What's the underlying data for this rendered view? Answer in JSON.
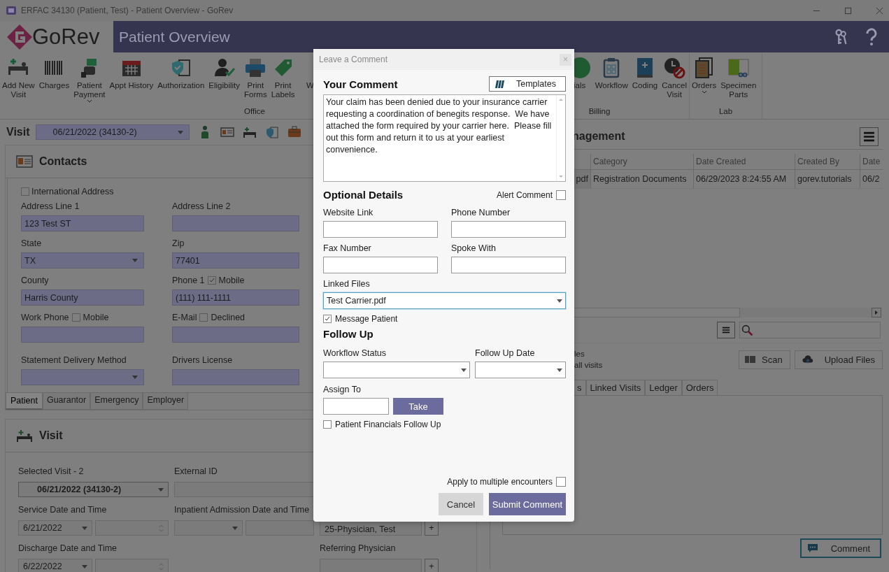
{
  "window": {
    "title": "ERFAC 34130 (Patient, Test) - Patient Overview - GoRev"
  },
  "header": {
    "logo": "GoRev",
    "title": "Patient Overview"
  },
  "ribbon": {
    "groups": [
      {
        "label": "Office",
        "items": [
          {
            "label": "Add New\nVisit",
            "dropdown": false
          },
          {
            "label": "Charges",
            "dropdown": false
          },
          {
            "label": "Patient\nPayment",
            "dropdown": true
          },
          {
            "label": "Appt History",
            "dropdown": false
          },
          {
            "label": "Authorization",
            "dropdown": false
          },
          {
            "label": "Eligibility",
            "dropdown": false
          },
          {
            "label": "Print\nForms",
            "dropdown": false
          },
          {
            "label": "Print\nLabels",
            "dropdown": false
          },
          {
            "label": "W",
            "dropdown": false
          }
        ]
      },
      {
        "label": "Billing",
        "items": [
          {
            "label": "ials",
            "dropdown": false
          },
          {
            "label": "Workflow",
            "dropdown": false
          },
          {
            "label": "Coding",
            "dropdown": false
          },
          {
            "label": "Cancel\nVisit",
            "dropdown": false
          }
        ]
      },
      {
        "label": "Lab",
        "items": [
          {
            "label": "Orders",
            "dropdown": true
          },
          {
            "label": "Specimen\nParts",
            "dropdown": false
          }
        ]
      }
    ]
  },
  "visit_bar": {
    "label": "Visit",
    "value": "06/21/2022 (34130-2)"
  },
  "contacts": {
    "title": "Contacts",
    "international": {
      "label": "International Address",
      "checked": false
    },
    "fields": [
      {
        "label": "Address Line 1",
        "kind": "text",
        "value": "123 Test ST"
      },
      {
        "label": "Address Line 2",
        "kind": "text"
      },
      {
        "label": "State",
        "kind": "select",
        "value": "TX"
      },
      {
        "label": "Zip",
        "kind": "text",
        "value": "77401"
      },
      {
        "label": "County",
        "kind": "text",
        "value": "Harris County"
      },
      {
        "label": "Phone 1",
        "kind": "text",
        "value": "(111) 111-1111",
        "option": {
          "label": "Mobile",
          "checked": true
        }
      },
      {
        "label": "Work Phone",
        "kind": "text",
        "option": {
          "label": "Mobile",
          "checked": false
        }
      },
      {
        "label": "E-Mail",
        "kind": "text",
        "option": {
          "label": "Declined",
          "checked": false
        }
      },
      {
        "label": "Statement Delivery Method",
        "kind": "select"
      },
      {
        "label": "Drivers License",
        "kind": "text"
      }
    ],
    "tabs": [
      {
        "label": "Patient",
        "selected": true
      },
      {
        "label": "Guarantor",
        "selected": false
      },
      {
        "label": "Emergency",
        "selected": false
      },
      {
        "label": "Employer",
        "selected": false
      }
    ]
  },
  "visit": {
    "title": "Visit",
    "selected_visit_label": "Selected Visit - 2",
    "selected_visit": "06/21/2022 (34130-2)",
    "external_id_label": "External ID",
    "service_label": "Service Date and Time",
    "service_date": "6/21/2022",
    "inpatient_label": "Inpatient Admission Date and Time",
    "physician": "25-Physician, Test",
    "physician_add": "+",
    "discharge_label": "Discharge Date and Time",
    "discharge_date": "6/22/2022",
    "referring_label": "Referring Physician",
    "referring_add": "+"
  },
  "documents": {
    "title": "nagement",
    "columns": [
      "",
      "Category",
      "Date Created",
      "Created By",
      "Date"
    ],
    "rows": [
      [
        "pdf",
        "Registration Documents",
        "06/29/2023 8:24:55 AM",
        "gorev.tutorials",
        "06/2"
      ]
    ],
    "options": [
      "les",
      "all visits"
    ],
    "scan": "Scan",
    "upload": "Upload Files",
    "tabs": [
      {
        "label": "s",
        "selected": false
      },
      {
        "label": "Linked Visits",
        "selected": false
      },
      {
        "label": "Ledger",
        "selected": false
      },
      {
        "label": "Orders",
        "selected": false
      }
    ],
    "comment_button": "Comment"
  },
  "dialog": {
    "title": "Leave a Comment",
    "close": "×",
    "comment_heading": "Your Comment",
    "templates_button": "Templates",
    "comment": "Your claim has been denied due to your insurance carrier requesting a coordination of benegits response.  We have attached the form required by your carrier here.  Please fill out this form and return it to us at your earliest convenience.",
    "optional_heading": "Optional Details",
    "alert": {
      "label": "Alert Comment",
      "checked": false
    },
    "fields": [
      {
        "label": "Website Link"
      },
      {
        "label": "Phone Number"
      },
      {
        "label": "Fax Number"
      },
      {
        "label": "Spoke With"
      }
    ],
    "linked_files_label": "Linked Files",
    "linked_files": "Test Carrier.pdf",
    "message_patient": {
      "label": "Message Patient",
      "checked": true
    },
    "follow_up_heading": "Follow Up",
    "workflow_status_label": "Workflow Status",
    "follow_up_date_label": "Follow Up Date",
    "assign_to_label": "Assign To",
    "take_button": "Take",
    "financials": {
      "label": "Patient Financials Follow Up",
      "checked": false
    },
    "apply_multiple": {
      "label": "Apply to multiple encounters",
      "checked": false
    },
    "cancel_button": "Cancel",
    "submit_button": "Submit Comment"
  }
}
